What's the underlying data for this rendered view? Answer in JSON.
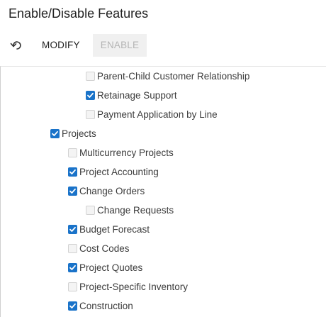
{
  "page": {
    "title": "Enable/Disable Features"
  },
  "toolbar": {
    "undo_icon": "undo-icon",
    "modify_label": "MODIFY",
    "enable_label": "ENABLE",
    "enable_disabled": true
  },
  "features": [
    {
      "label": "Parent-Child Customer Relationship",
      "level": 3,
      "checked": false
    },
    {
      "label": "Retainage Support",
      "level": 3,
      "checked": true
    },
    {
      "label": "Payment Application by Line",
      "level": 3,
      "checked": false
    },
    {
      "label": "Projects",
      "level": 1,
      "checked": true
    },
    {
      "label": "Multicurrency Projects",
      "level": 2,
      "checked": false
    },
    {
      "label": "Project Accounting",
      "level": 2,
      "checked": true
    },
    {
      "label": "Change Orders",
      "level": 2,
      "checked": true
    },
    {
      "label": "Change Requests",
      "level": 3,
      "checked": false
    },
    {
      "label": "Budget Forecast",
      "level": 2,
      "checked": true
    },
    {
      "label": "Cost Codes",
      "level": 2,
      "checked": false
    },
    {
      "label": "Project Quotes",
      "level": 2,
      "checked": true
    },
    {
      "label": "Project-Specific Inventory",
      "level": 2,
      "checked": false
    },
    {
      "label": "Construction",
      "level": 2,
      "checked": true
    }
  ],
  "colors": {
    "checkbox_checked": "#1a73c9",
    "disabled_button_bg": "#f0f0f0",
    "disabled_button_text": "#b4b4b4"
  }
}
